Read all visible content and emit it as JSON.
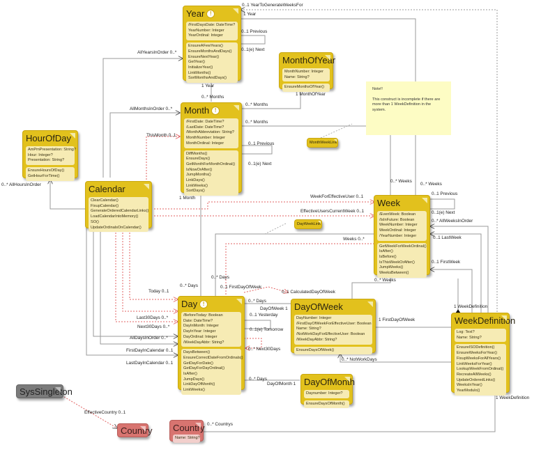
{
  "classes": {
    "year": {
      "name": "Year",
      "warning": "!",
      "attributes": [
        "/FirstDaysDate: DateTime?",
        "YearNumber: Integer",
        "YearOrdinal: Integer"
      ],
      "methods": [
        "EnsureAFewYears()",
        "EnsureMonthsAndDays()",
        "EnsureNextYear()",
        "GetYear()",
        "InitializeYear()",
        "LinkMonths()",
        "SortMonthsAndDays()"
      ]
    },
    "month_of_year": {
      "name": "MonthOfYear",
      "attributes": [
        "MonthNumber: Integer",
        "Name: String?"
      ],
      "methods": [
        "EnsureMonthsOfYear()"
      ]
    },
    "month": {
      "name": "Month",
      "warning": "!",
      "attributes": [
        "/FirstDate: DateTime?",
        "/LastDate: DateTime?",
        "/MonthAbbreviation: String?",
        "MonthNumber: Integer",
        "MonthOrdinal: Integer"
      ],
      "methods": [
        "DiffMonths()",
        "EnsureDays()",
        "GetMonthForMonthOrdinal()",
        "IsNowOrAfter()",
        "JumpMonths()",
        "LinkDays()",
        "LinkWeeks()",
        "SortDays()"
      ]
    },
    "hour_of_day": {
      "name": "HourOfDay",
      "attributes": [
        "AmPmPresentation: String?",
        "Hour: Integer?",
        "Presentation: String?"
      ],
      "methods": [
        "EnsureHoursOfDay()",
        "GetHourForTime()"
      ]
    },
    "calendar": {
      "name": "Calendar",
      "methods": [
        "ClearCalendar()",
        "FixupCalendar()",
        "GenerateOrderedCalendarLinks()",
        "LoadCalendarIntoMemory()",
        "SO()",
        "UpdateOrdinalsOnCalendar()"
      ]
    },
    "week": {
      "name": "Week",
      "attributes": [
        "/EvenWeek: Boolean",
        "/IsInFuture: Boolean",
        "WeekNumber: Integer",
        "WeekOrdinal: Integer",
        "/YearNumber: Integer"
      ],
      "methods": [
        "GetWeekForWeekOrdinal()",
        "IsAfter()",
        "IsBefore()",
        "IsThisWeekOrAfter()",
        "JumpWeeks()",
        "WeeksBetween()"
      ]
    },
    "day": {
      "name": "Day",
      "warning": "!",
      "attributes": [
        "/BeforeToday: Boolean",
        "Date: DateTime?",
        "DayInMonth: Integer",
        "DayInYear: Integer",
        "DayOrdinal: Integer",
        "/WeekDayAbbr: String?"
      ],
      "methods": [
        "DaysBetween()",
        "EnsureCorrectDateFromOrdinals()",
        "GetDayForDate()",
        "GetDayForDayOrdinal()",
        "IsAfter()",
        "JumpDays()",
        "LinkDayOfMonth()",
        "LinkWeeks()"
      ]
    },
    "day_of_week": {
      "name": "DayOfWeek",
      "attributes": [
        "DayNumber: Integer",
        "/FirstDayOfWeekForEffectiveUser: Boolean",
        "Name: String?",
        "/NotWorkDayForEffectiveUser: Boolean",
        "/WeekDayAbbr: String?"
      ],
      "methods": [
        "EnsureDaysOfWeek()"
      ]
    },
    "week_definition": {
      "name": "WeekDefinition",
      "attributes": [
        "Log: Text?",
        "Name: String?"
      ],
      "methods": [
        "EnsureISODefinition()",
        "EnsureWeeksForYear()",
        "FixupWeeksForAllYears()",
        "LinkWeeksForYear()",
        "LookupWeekFromOrdinal()",
        "RecreateAllWeeks()",
        "UpdateOrderedLinks()",
        "WeeksInYear()",
        "YearModulo()"
      ]
    },
    "day_of_month": {
      "name": "DayOfMonth",
      "attributes": [
        "Daynumber: Integer?"
      ],
      "methods": [
        "EnsureDaysOfMonth()"
      ]
    },
    "sys_singleton": {
      "name": "SysSingleton"
    },
    "country_ref": {
      "name": "Country"
    },
    "country": {
      "name": "Country",
      "attributes": [
        "Name: String?"
      ]
    },
    "month_week_link": {
      "name": "MonthWeekLink"
    },
    "day_week_link": {
      "name": "DayWeekLink"
    }
  },
  "note": {
    "title": "Note!!",
    "text": "This construct is incomplete if there are more than 1 WeekDefinition in the system."
  },
  "labels": {
    "year_to_generate": "0..1 YearToGenerateWeeksFor",
    "one_year_top": "1 Year",
    "year_previous": "0..1 Previous",
    "year_next": "0..1(e) Next",
    "all_years": "AllYearsInOrder 0..*",
    "one_year": "1 Year",
    "months_year": "0..* Months",
    "months_moy": "0..* Months",
    "one_month_of_year": "1 MonthOfYear",
    "all_months": "AllMonthsInOrder 0..*",
    "months_week": "0..* Months",
    "this_month": "ThisMonth 0..1",
    "month_previous": "0..1 Previous",
    "month_next": "0..1(e) Next",
    "all_hours": "0..* AllHoursInOrder",
    "one_month": "1 Month",
    "weeks_month": "0..* Weeks",
    "weeks_year": "0..* Weeks",
    "week_previous": "0..1 Previous",
    "week_next": "0..1(e) Next",
    "all_weeks": "0..* AllWeeksInOrder",
    "last_week": "0..1 LastWeek",
    "first_week": "0..1 FirstWeek",
    "week_for_user": "WeekForEffectiveUser 0..1",
    "users_current_week": "EffectiveUsersCurrentWeek 0..1",
    "weeks_day": "Weeks 0..*",
    "days_week": "0..* Days",
    "days_month": "0..* Days",
    "weeks_dow": "0..* Weeks",
    "one_week_definition": "1 WeekDefinition",
    "first_day_of_week": "0..1 FirstDayOfWeek",
    "calculated_dow": "0..1 CalculatedDayOfWeek",
    "days_dow": "0..* Days",
    "day_of_week_1": "DayOfWeek 1",
    "yesterday": "0..1 Yesterday",
    "tomorrow": "0..1(e) Tomorrow",
    "next30_right": "0..* Next30Days",
    "today": "Today 0..1",
    "last30": "Last30Days 0..*",
    "next30": "Next30Days 0..*",
    "all_days": "AllDaysInOrder 0..*",
    "first_day_cal": "FirstDayInCalendar 0..1",
    "last_day_cal": "LastDayInCalendar 0..1",
    "wd_first_day": "1 FirstDayOfWeek",
    "not_work_days": "0..* NotWorkDays",
    "days_dom": "0..* Days",
    "day_of_month_1": "DayOfMonth 1",
    "one_week_definition_bottom": "1 WeekDefinition",
    "effective_country": "EffectiveCountry 0..1",
    "countrys": "0..* Countrys"
  }
}
